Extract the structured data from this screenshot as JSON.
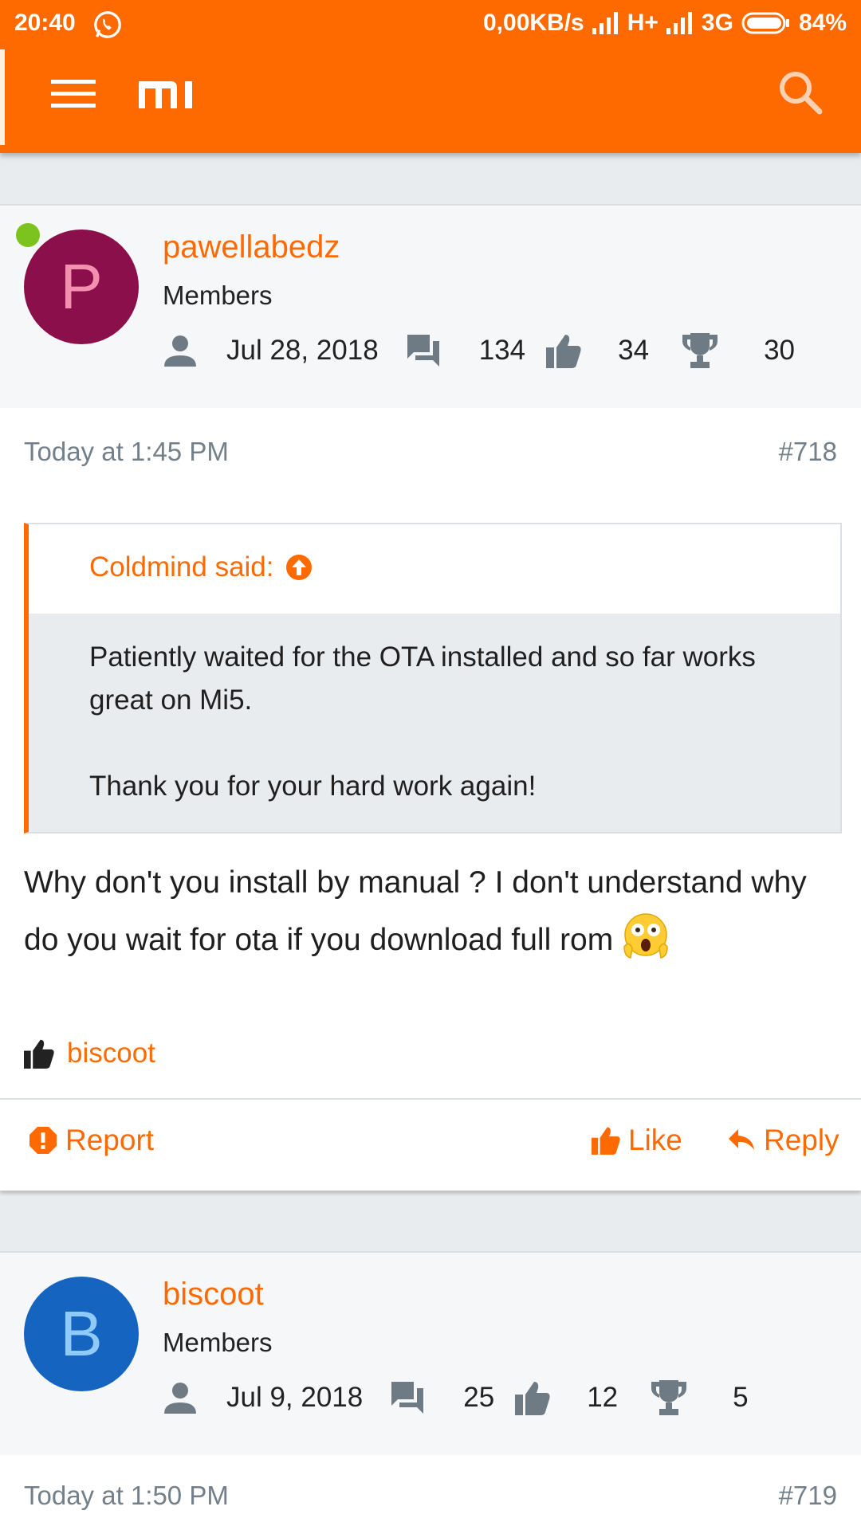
{
  "status_bar": {
    "time": "20:40",
    "net_speed": "0,00KB/s",
    "net_type1": "H+",
    "net_type2": "3G",
    "battery": "84%"
  },
  "app_bar": {
    "logo_text": "mi",
    "icons": [
      "menu-icon",
      "search-icon"
    ]
  },
  "posts": [
    {
      "avatar_letter": "P",
      "avatar_color": "#8a0f4a",
      "avatar_letter_color": "#f48fb1",
      "online": true,
      "username": "pawellabedz",
      "role": "Members",
      "joined": "Jul 28, 2018",
      "messages": "134",
      "likes": "34",
      "trophies": "30",
      "timestamp": "Today at 1:45 PM",
      "post_number": "#718",
      "quote": {
        "author": "Coldmind said:",
        "lines": [
          "Patiently waited for the OTA installed and so far works great on Mi5.",
          "Thank you for your hard work again!"
        ]
      },
      "message": "Why don't you install by manual ? I don't understand why do you wait for ota if you download full rom",
      "liked_by": "biscoot",
      "actions": {
        "report": "Report",
        "like": "Like",
        "reply": "Reply"
      }
    },
    {
      "avatar_letter": "B",
      "avatar_color": "#1565c0",
      "avatar_letter_color": "#90caf9",
      "online": false,
      "username": "biscoot",
      "role": "Members",
      "joined": "Jul 9, 2018",
      "messages": "25",
      "likes": "12",
      "trophies": "5",
      "timestamp": "Today at 1:50 PM",
      "post_number": "#719"
    }
  ],
  "colors": {
    "accent": "#ff6a00",
    "muted_text": "#737f89",
    "page_bg": "#e9ecef"
  }
}
